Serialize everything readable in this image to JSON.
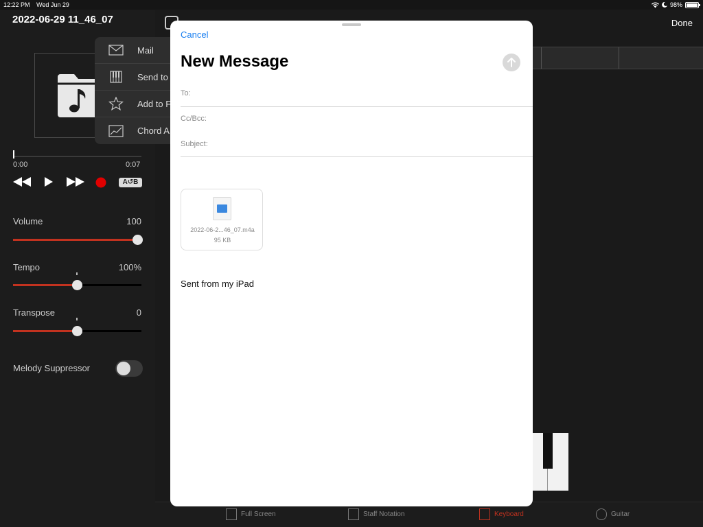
{
  "status_bar": {
    "time": "12:22 PM",
    "date": "Wed Jun 29",
    "battery": "98%"
  },
  "player": {
    "title": "2022-06-29 11_46_07",
    "time_start": "0:00",
    "time_end": "0:07",
    "ab_label": "A↺B",
    "volume": {
      "label": "Volume",
      "value": "100",
      "level": 1.0
    },
    "tempo": {
      "label": "Tempo",
      "value": "100%",
      "level": 0.5
    },
    "transpose": {
      "label": "Transpose",
      "value": "0",
      "level": 0.5
    },
    "melody_suppressor": {
      "label": "Melody Suppressor",
      "on": false
    }
  },
  "menu": {
    "items": [
      {
        "label": "Mail",
        "icon": "envelope-icon"
      },
      {
        "label": "Send to",
        "icon": "piano-keys-icon"
      },
      {
        "label": "Add to F",
        "icon": "star-icon"
      },
      {
        "label": "Chord A",
        "icon": "chart-icon"
      }
    ]
  },
  "right_header": {
    "done_label": "Done"
  },
  "bottom_tabs": [
    {
      "label": "Full Screen",
      "active": false
    },
    {
      "label": "Staff Notation",
      "active": false
    },
    {
      "label": "Keyboard",
      "active": true
    },
    {
      "label": "Guitar",
      "active": false
    }
  ],
  "mail": {
    "cancel_label": "Cancel",
    "heading": "New Message",
    "to_label": "To:",
    "ccbcc_label": "Cc/Bcc:",
    "subject_label": "Subject:",
    "attachment": {
      "name": "2022-06-2...46_07.m4a",
      "size": "95 KB"
    },
    "signature": "Sent from my iPad"
  },
  "colors": {
    "accent": "#c2321f",
    "link": "#1a7ff0",
    "record": "#e00000"
  }
}
